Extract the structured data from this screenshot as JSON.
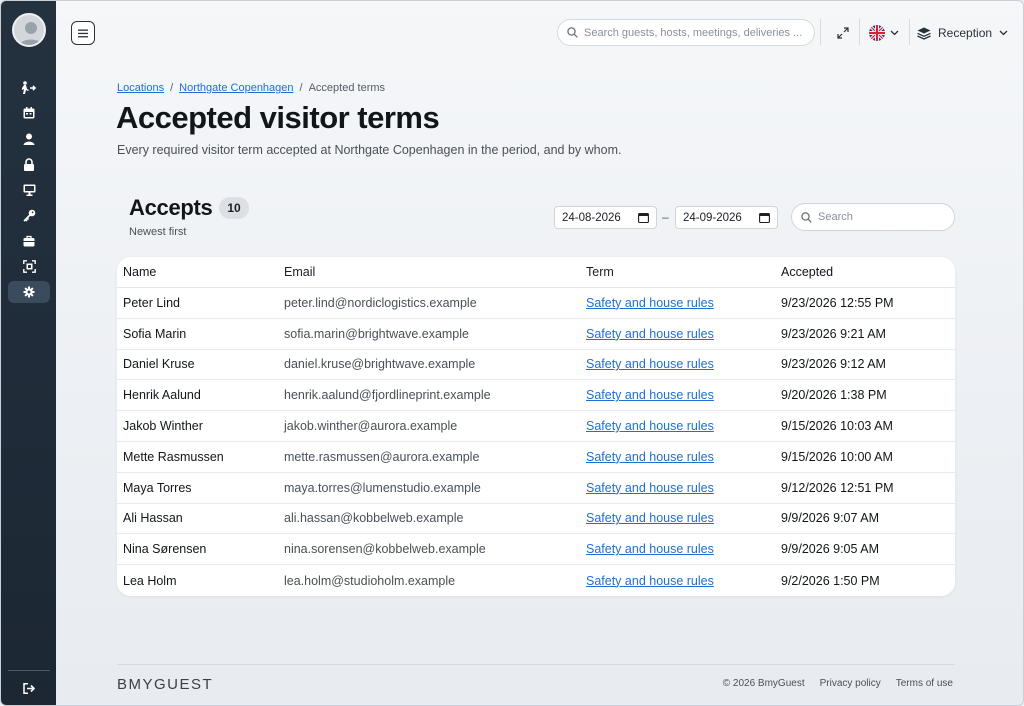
{
  "topbar": {
    "search_placeholder": "Search guests, hosts, meetings, deliveries ...",
    "location_label": "Reception"
  },
  "sidebar": {
    "items": [
      {
        "icon": "visitor-arrival-icon"
      },
      {
        "icon": "calendar-icon"
      },
      {
        "icon": "user-icon"
      },
      {
        "icon": "lock-icon"
      },
      {
        "icon": "monitor-icon"
      },
      {
        "icon": "key-icon"
      },
      {
        "icon": "briefcase-icon"
      },
      {
        "icon": "scan-icon"
      },
      {
        "icon": "gear-icon",
        "active": true
      }
    ],
    "logout_icon": "logout-icon"
  },
  "breadcrumb": {
    "items": [
      "Locations",
      "Northgate Copenhagen",
      "Accepted terms"
    ],
    "separator": "/"
  },
  "page": {
    "title": "Accepted visitor terms",
    "description": "Every required visitor term accepted at Northgate Copenhagen in the period, and by whom."
  },
  "accepts": {
    "title": "Accepts",
    "count": "10",
    "sort_label": "Newest first",
    "date_from": "24-08-2026",
    "date_separator": "–",
    "date_to": "24-09-2026",
    "search_placeholder": "Search"
  },
  "table": {
    "headers": [
      "Name",
      "Email",
      "Term",
      "Accepted"
    ],
    "rows": [
      [
        "Peter Lind",
        "peter.lind@nordiclogistics.example",
        "Safety and house rules",
        "9/23/2026 12:55 PM"
      ],
      [
        "Sofia Marin",
        "sofia.marin@brightwave.example",
        "Safety and house rules",
        "9/23/2026 9:21 AM"
      ],
      [
        "Daniel Kruse",
        "daniel.kruse@brightwave.example",
        "Safety and house rules",
        "9/23/2026 9:12 AM"
      ],
      [
        "Henrik Aalund",
        "henrik.aalund@fjordlineprint.example",
        "Safety and house rules",
        "9/20/2026 1:38 PM"
      ],
      [
        "Jakob Winther",
        "jakob.winther@aurora.example",
        "Safety and house rules",
        "9/15/2026 10:03 AM"
      ],
      [
        "Mette Rasmussen",
        "mette.rasmussen@aurora.example",
        "Safety and house rules",
        "9/15/2026 10:00 AM"
      ],
      [
        "Maya Torres",
        "maya.torres@lumenstudio.example",
        "Safety and house rules",
        "9/12/2026 12:51 PM"
      ],
      [
        "Ali Hassan",
        "ali.hassan@kobbelweb.example",
        "Safety and house rules",
        "9/9/2026 9:07 AM"
      ],
      [
        "Nina Sørensen",
        "nina.sorensen@kobbelweb.example",
        "Safety and house rules",
        "9/9/2026 9:05 AM"
      ],
      [
        "Lea Holm",
        "lea.holm@studioholm.example",
        "Safety and house rules",
        "9/2/2026 1:50 PM"
      ]
    ]
  },
  "footer": {
    "logo": "BMYGUEST",
    "copyright": "© 2026 BmyGuest",
    "privacy": "Privacy policy",
    "terms": "Terms of use"
  }
}
